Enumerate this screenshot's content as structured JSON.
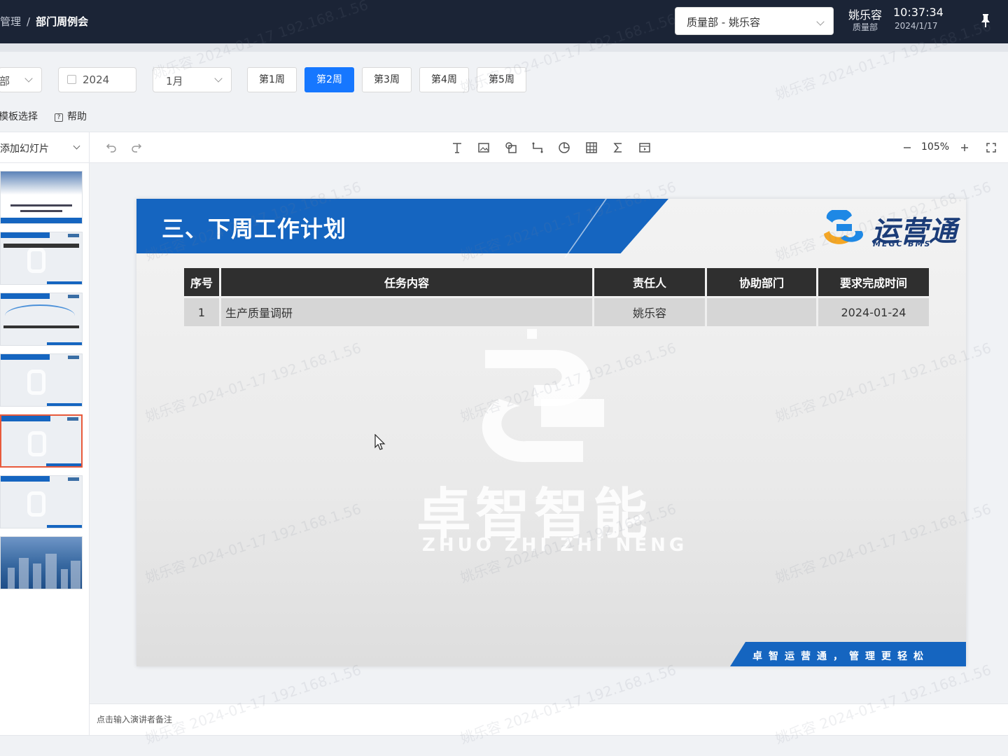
{
  "header": {
    "breadcrumb_parent": "管理",
    "breadcrumb_sep": "/",
    "breadcrumb_current": "部门周例会",
    "dept_select_value": "质量部 - 姚乐容",
    "user_name": "姚乐容",
    "user_time": "10:37:34",
    "user_dept": "质量部",
    "user_date": "2024/1/17"
  },
  "filters": {
    "dept_value": "部",
    "year_value": "2024",
    "month_value": "1月",
    "weeks": [
      "第1周",
      "第2周",
      "第3周",
      "第4周",
      "第5周"
    ],
    "active_week": "第2周"
  },
  "tools": {
    "template_label": "模板选择",
    "help_label": "帮助"
  },
  "editor": {
    "add_slide_label": "添加幻灯片",
    "zoom": "105%",
    "notes_placeholder": "点击输入演讲者备注"
  },
  "thumbnails": {
    "count": 7,
    "selected_index": 4
  },
  "slide": {
    "title": "三、下周工作计划",
    "brand_name": "运营通",
    "brand_sub": "MEGC-BMS",
    "table": {
      "headers": [
        "序号",
        "任务内容",
        "责任人",
        "协助部门",
        "要求完成时间"
      ],
      "rows": [
        [
          "1",
          "生产质量调研",
          "姚乐容",
          "",
          "2024-01-24"
        ]
      ]
    },
    "watermark_cn": "卓智智能",
    "watermark_en": "ZHUO ZHI ZHI NENG",
    "slogan": "卓智运营通，管理更轻松"
  },
  "page_watermark": "姚乐容 2024-01-17 192.168.1.56",
  "colors": {
    "topbar": "#1b2436",
    "accent_blue": "#1677ff",
    "slide_blue": "#1565c0",
    "table_header": "#2f2f2f",
    "selected_thumb_border": "#e85a3b"
  }
}
